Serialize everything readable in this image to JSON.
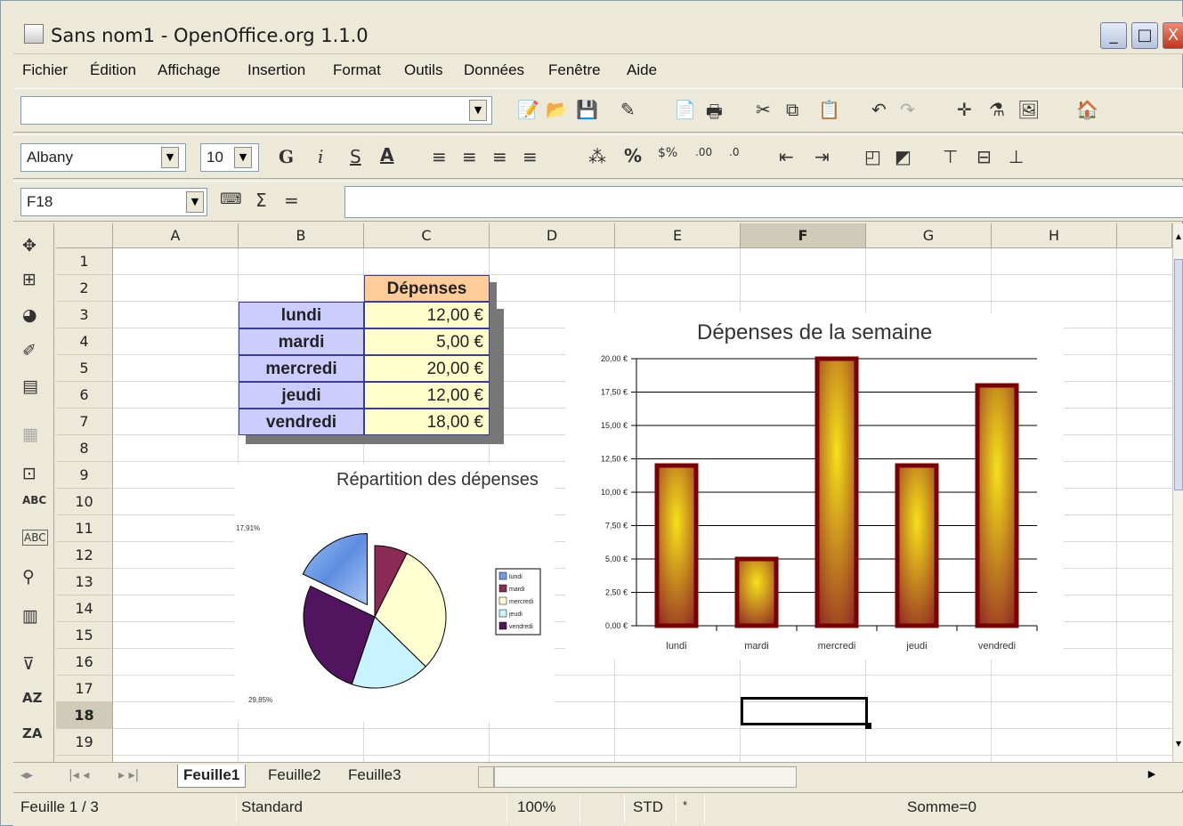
{
  "window": {
    "title": "Sans nom1 - OpenOffice.org 1.1.0",
    "minimize": "_",
    "maximize": "□",
    "close": "X"
  },
  "menu": [
    "Fichier",
    "Édition",
    "Affichage",
    "Insertion",
    "Format",
    "Outils",
    "Données",
    "Fenêtre",
    "Aide"
  ],
  "toolbar": {
    "url_value": "",
    "font_name": "Albany",
    "font_size": "10",
    "bold": "G",
    "italic": "i",
    "underline": "S",
    "underline_a": "A",
    "percent": "%",
    "name_box": "F18",
    "sum": "Σ",
    "equals": "=",
    "formula_value": ""
  },
  "columns": [
    "A",
    "B",
    "C",
    "D",
    "E",
    "F",
    "G",
    "H"
  ],
  "rows": [
    "1",
    "2",
    "3",
    "4",
    "5",
    "6",
    "7",
    "8",
    "9",
    "10",
    "11",
    "12",
    "13",
    "14",
    "15",
    "16",
    "17",
    "18",
    "19"
  ],
  "table": {
    "header": "Dépenses",
    "rows": [
      {
        "day": "lundi",
        "amount": "12,00 €"
      },
      {
        "day": "mardi",
        "amount": "5,00 €"
      },
      {
        "day": "mercredi",
        "amount": "20,00 €"
      },
      {
        "day": "jeudi",
        "amount": "12,00 €"
      },
      {
        "day": "vendredi",
        "amount": "18,00 €"
      }
    ]
  },
  "chart_data": [
    {
      "type": "bar",
      "title": "Dépenses de la semaine",
      "categories": [
        "lundi",
        "mardi",
        "mercredi",
        "jeudi",
        "vendredi"
      ],
      "values": [
        12,
        5,
        20,
        12,
        18
      ],
      "ylim": [
        0,
        20
      ],
      "yticks": [
        "0,00 €",
        "2,50 €",
        "5,00 €",
        "7,50 €",
        "10,00 €",
        "12,50 €",
        "15,00 €",
        "17,50 €",
        "20,00 €"
      ],
      "grid": true,
      "colors": {
        "bar_edge": "#7a0000",
        "bar_fill_top": "#f6e21a",
        "bar_fill_bottom": "#8e2424"
      }
    },
    {
      "type": "pie",
      "title": "Répartition des dépenses",
      "categories": [
        "lundi",
        "mardi",
        "mercredi",
        "jeudi",
        "vendredi"
      ],
      "values": [
        12,
        5,
        20,
        12,
        18
      ],
      "slice_labels": [
        "17,91%",
        "29,85%"
      ],
      "legend": "right",
      "colors": [
        "#6f9be8",
        "#8b2a54",
        "#ffffd0",
        "#c8f4ff",
        "#52145f"
      ]
    }
  ],
  "tabs": [
    "Feuille1",
    "Feuille2",
    "Feuille3"
  ],
  "status": {
    "sheet": "Feuille 1 / 3",
    "style": "Standard",
    "zoom": "100%",
    "mode": "STD",
    "modified": "*",
    "sum": "Somme=0"
  }
}
